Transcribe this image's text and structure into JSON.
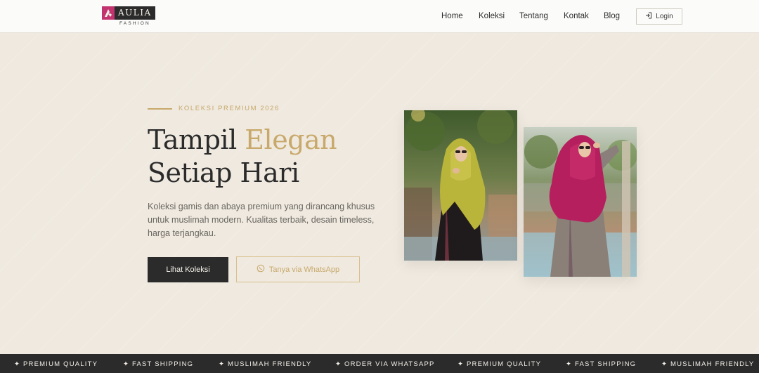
{
  "brand": {
    "name": "AULIA",
    "tagline": "FASHION",
    "colors": {
      "accent": "#c8a96b",
      "dark": "#2b2b2b",
      "brand_pink": "#c2336f",
      "background": "#efe9df"
    }
  },
  "nav": {
    "items": [
      {
        "label": "Home"
      },
      {
        "label": "Koleksi"
      },
      {
        "label": "Tentang"
      },
      {
        "label": "Kontak"
      },
      {
        "label": "Blog"
      }
    ],
    "login_label": "Login",
    "login_icon": "login-icon"
  },
  "hero": {
    "eyebrow": "KOLEKSI PREMIUM 2026",
    "headline_part1": "Tampil ",
    "headline_accent": "Elegan",
    "headline_line2": "Setiap Hari",
    "description": "Koleksi gamis dan abaya premium yang dirancang khusus untuk muslimah modern. Kualitas terbaik, desain timeless, harga terjangkau.",
    "primary_button": "Lihat Koleksi",
    "secondary_button": "Tanya via WhatsApp",
    "secondary_icon": "whatsapp-icon"
  },
  "marquee": {
    "items": [
      "✦ PREMIUM QUALITY",
      "✦ FAST SHIPPING",
      "✦ MUSLIMAH FRIENDLY",
      "✦ ORDER VIA WHATSAPP",
      "✦ PREMIUM QUALITY",
      "✦ FAST SHIPPING",
      "✦ MUSLIMAH FRIENDLY"
    ]
  }
}
